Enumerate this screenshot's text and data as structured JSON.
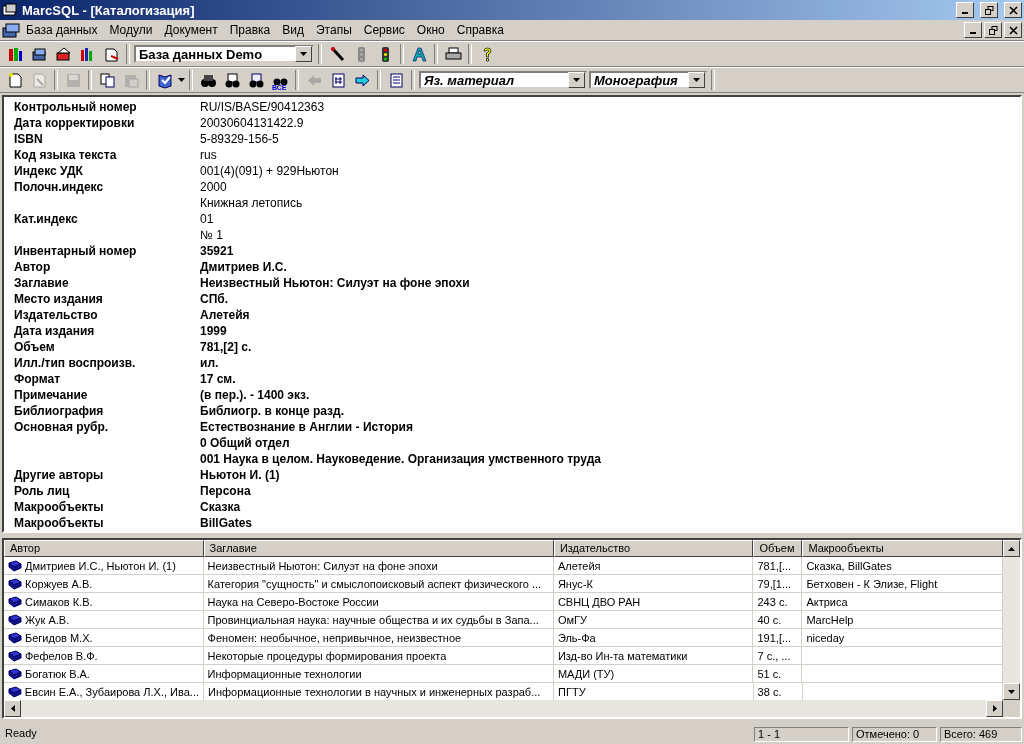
{
  "window": {
    "title": "MarcSQL - [Каталогизация]"
  },
  "menu": [
    "База данных",
    "Модули",
    "Документ",
    "Правка",
    "Вид",
    "Этапы",
    "Сервис",
    "Окно",
    "Справка"
  ],
  "toolbar1": {
    "database": "База данных Demo"
  },
  "toolbar2": {
    "buttons": [
      {
        "disabled": false
      },
      {
        "disabled": true
      },
      {
        "disabled": true
      },
      {
        "disabled": false
      },
      {
        "disabled": true
      },
      {
        "disabled": false
      },
      {
        "disabled": false
      },
      {
        "disabled": false
      },
      {
        "disabled": false
      },
      {
        "disabled": false,
        "label": "ВСЕ"
      },
      {
        "disabled": true
      },
      {
        "disabled": false
      },
      {
        "disabled": false
      },
      {
        "disabled": false
      }
    ],
    "selects": [
      "Яз. материал",
      "Монография"
    ]
  },
  "record": [
    {
      "label": "Контрольный номер",
      "value": "RU/IS/BASE/90412363",
      "bold": false
    },
    {
      "label": "Дата корректировки",
      "value": "20030604131422.9",
      "bold": false
    },
    {
      "label": "ISBN",
      "value": "5-89329-156-5",
      "bold": false
    },
    {
      "label": "Код языка текста",
      "value": "rus",
      "bold": false
    },
    {
      "label": "Индекс УДК",
      "value": "001(4)(091) + 929Ньютон",
      "bold": false
    },
    {
      "label": "Полочн.индекс",
      "value": "2000",
      "bold": false
    },
    {
      "value": "Книжная летопись",
      "bold": false
    },
    {
      "label": "Кат.индекс",
      "value": "01",
      "bold": false
    },
    {
      "value": "№ 1",
      "bold": false
    },
    {
      "label": "Инвентарный номер",
      "value": "35921",
      "bold": true
    },
    {
      "label": "Автор",
      "value": "Дмитриев И.С.",
      "bold": true
    },
    {
      "label": "Заглавие",
      "value": "Неизвестный Ньютон: Силуэт на фоне эпохи",
      "bold": true
    },
    {
      "label": "Место издания",
      "value": "СПб.",
      "bold": true
    },
    {
      "label": "Издательство",
      "value": "Алетейя",
      "bold": true
    },
    {
      "label": "Дата издания",
      "value": "1999",
      "bold": true
    },
    {
      "label": "Объем",
      "value": "781,[2] с.",
      "bold": true
    },
    {
      "label": "Илл./тип воспроизв.",
      "value": "ил.",
      "bold": true
    },
    {
      "label": "Формат",
      "value": "17 см.",
      "bold": true
    },
    {
      "label": "Примечание",
      "value": "(в пер.). - 1400 экз.",
      "bold": true
    },
    {
      "label": "Библиография",
      "value": "Библиогр. в конце разд.",
      "bold": true
    },
    {
      "label": "Основная рубр.",
      "value": "Естествознание в Англии - История",
      "bold": true
    },
    {
      "value": "0 Общий отдел",
      "bold": true
    },
    {
      "value": "001 Наука в целом. Науковедение. Организация умственного труда",
      "bold": true
    },
    {
      "label": "Другие авторы",
      "value": "Ньютон И. (1)",
      "bold": true
    },
    {
      "label": "Роль лиц",
      "value": "Персона",
      "bold": true
    },
    {
      "label": "Макрообъекты",
      "value": "Сказка",
      "bold": true
    },
    {
      "label": "Макрообъекты",
      "value": "BillGates",
      "bold": true
    }
  ],
  "table": {
    "columns": [
      "Автор",
      "Заглавие",
      "Издательство",
      "Объем",
      "Макрообъекты"
    ],
    "rows": [
      [
        "Дмитриев И.С., Ньютон И. (1)",
        "Неизвестный Ньютон: Силуэт на фоне эпохи",
        "Алетейя",
        "781,[...",
        "Сказка, BillGates"
      ],
      [
        "Коржуев А.В.",
        "Категория \"сущность\" и смыслопоисковый аспект физического ...",
        "Янус-К",
        "79,[1...",
        "Бетховен - К Элизе, Flight"
      ],
      [
        "Симаков К.В.",
        "Наука на Северо-Востоке России",
        "СВНЦ ДВО РАН",
        "243 с.",
        "Актриса"
      ],
      [
        "Жук А.В.",
        "Провинциальная наука: научные общества и их судьбы в Запа...",
        "ОмГУ",
        "40 с.",
        "MarcHelp"
      ],
      [
        "Бегидов М.Х.",
        "Феномен: необычное, непривычное, неизвестное",
        "Эль-Фа",
        "191,[...",
        "niceday"
      ],
      [
        "Фефелов В.Ф.",
        "Некоторые процедуры формирования проекта",
        "Изд-во Ин-та математики",
        "7 с., ...",
        ""
      ],
      [
        "Богатюк В.А.",
        "Информационные технологии",
        "МАДИ (ТУ)",
        "51 с.",
        ""
      ],
      [
        "Евсин Е.А., Зубаирова Л.Х., Ива...",
        "Информационные технологии в научных и инженерных разраб...",
        "ПГТУ",
        "38 с.",
        ""
      ]
    ]
  },
  "status_bar": {
    "message": "Ready",
    "range": "1 - 1",
    "marked": "Отмечено: 0",
    "total": "Всего: 469"
  }
}
